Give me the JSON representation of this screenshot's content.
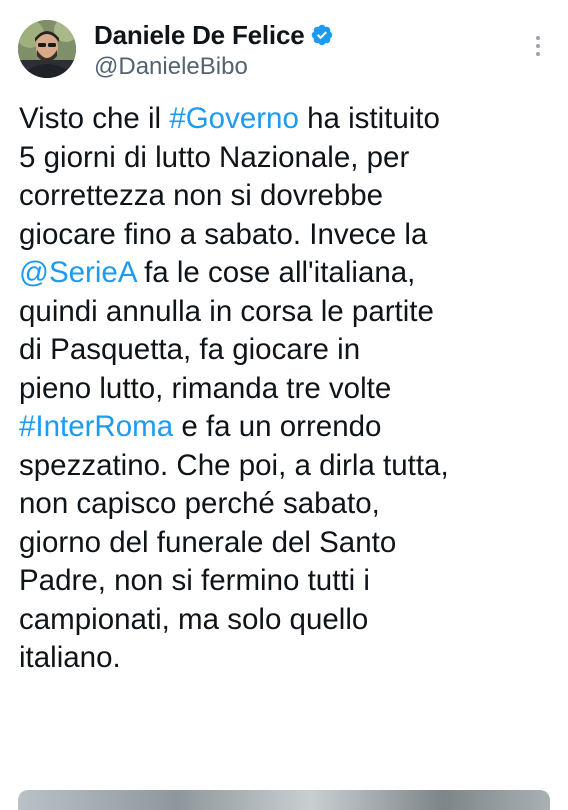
{
  "tweet": {
    "author": {
      "display_name": "Daniele De Felice",
      "handle": "@DanieleBibo",
      "verified": true,
      "avatar_icon": "profile-photo",
      "verified_icon": "verified-badge-icon"
    },
    "more_icon": "more-vertical-icon",
    "body_lines": [
      [
        {
          "text": "Visto che il "
        },
        {
          "text": "#Governo",
          "link": true
        },
        {
          "text": " ha istituito"
        }
      ],
      [
        {
          "text": "5 giorni di lutto Nazionale, per"
        }
      ],
      [
        {
          "text": "correttezza non si dovrebbe"
        }
      ],
      [
        {
          "text": "giocare fino a sabato. Invece la"
        }
      ],
      [
        {
          "text": "@SerieA",
          "link": true
        },
        {
          "text": " fa le cose all'italiana,"
        }
      ],
      [
        {
          "text": "quindi annulla in corsa le partite"
        }
      ],
      [
        {
          "text": "di Pasquetta, fa giocare in"
        }
      ],
      [
        {
          "text": "pieno lutto, rimanda tre volte"
        }
      ],
      [
        {
          "text": "#InterRoma",
          "link": true
        },
        {
          "text": " e fa un orrendo"
        }
      ],
      [
        {
          "text": "spezzatino. Che poi, a dirla tutta,"
        }
      ],
      [
        {
          "text": "non capisco perché sabato,"
        }
      ],
      [
        {
          "text": "giorno del funerale del Santo"
        }
      ],
      [
        {
          "text": "Padre, non si fermino tutti i"
        }
      ],
      [
        {
          "text": "campionati, ma solo quello"
        }
      ],
      [
        {
          "text": "italiano."
        }
      ]
    ]
  },
  "colors": {
    "link": "#1d9bf0",
    "text": "#0f1419",
    "secondary": "#536471",
    "verified": "#1d9bf0"
  }
}
